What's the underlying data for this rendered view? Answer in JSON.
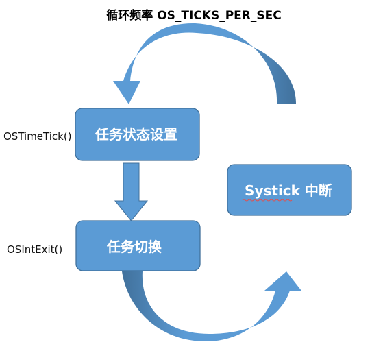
{
  "title": "循环频率 OS_TICKS_PER_SEC",
  "boxes": {
    "task_state": "任务状态设置",
    "task_switch": "任务切换",
    "systick": "Systick 中断"
  },
  "side_labels": {
    "ostimetick": "OSTimeTick()",
    "osintexit": "OSIntExit()"
  },
  "colors": {
    "box_fill": "#5b9bd5",
    "box_border": "#41719c",
    "arrow_light": "#5b9bd5",
    "arrow_dark": "#41719c",
    "underline": "#e05050"
  }
}
